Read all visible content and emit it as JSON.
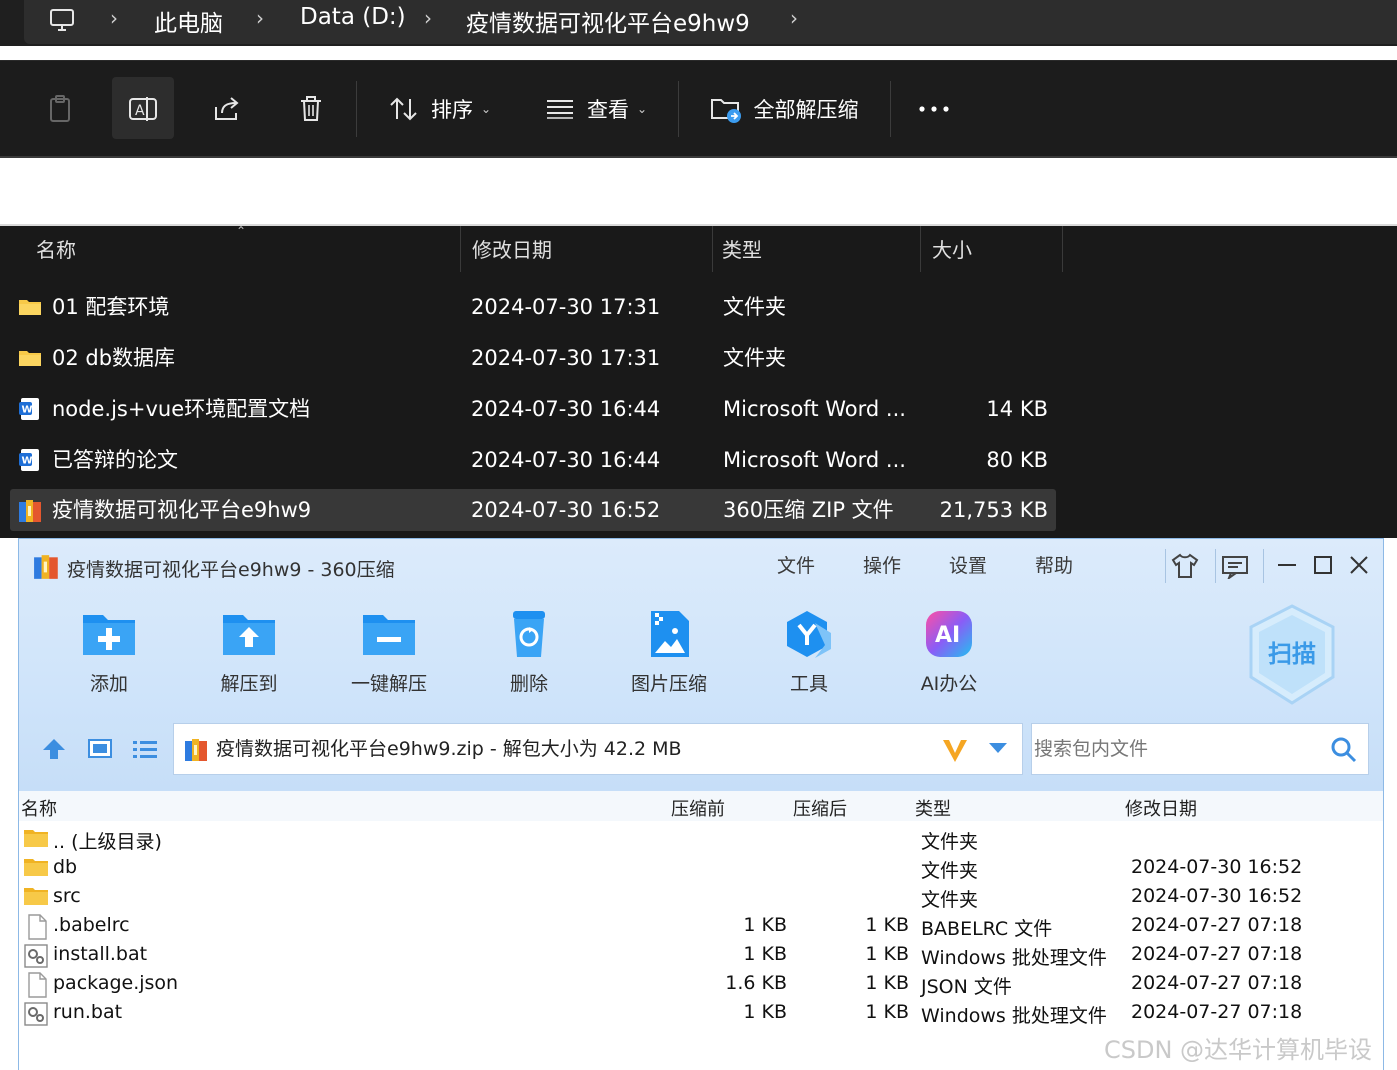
{
  "explorer": {
    "breadcrumb": [
      "此电脑",
      "Data (D:)",
      "疫情数据可视化平台e9hw9"
    ],
    "toolbar": {
      "sort_label": "排序",
      "view_label": "查看",
      "extract_all_label": "全部解压缩"
    },
    "columns": {
      "name": "名称",
      "modified": "修改日期",
      "type": "类型",
      "size": "大小"
    },
    "files": [
      {
        "name": "01 配套环境",
        "modified": "2024-07-30 17:31",
        "type": "文件夹",
        "size": "",
        "icon": "folder-icon"
      },
      {
        "name": "02 db数据库",
        "modified": "2024-07-30 17:31",
        "type": "文件夹",
        "size": "",
        "icon": "folder-icon"
      },
      {
        "name": "node.js+vue环境配置文档",
        "modified": "2024-07-30 16:44",
        "type": "Microsoft Word ...",
        "size": "14 KB",
        "icon": "word-doc-icon"
      },
      {
        "name": "已答辩的论文",
        "modified": "2024-07-30 16:44",
        "type": "Microsoft Word ...",
        "size": "80 KB",
        "icon": "word-doc-icon"
      },
      {
        "name": "疫情数据可视化平台e9hw9",
        "modified": "2024-07-30 16:52",
        "type": "360压缩 ZIP 文件",
        "size": "21,753 KB",
        "icon": "zip-archive-icon"
      }
    ]
  },
  "zip": {
    "title": "疫情数据可视化平台e9hw9 - 360压缩",
    "menu": [
      "文件",
      "操作",
      "设置",
      "帮助"
    ],
    "tools": [
      {
        "label": "添加",
        "icon": "add-folder-icon"
      },
      {
        "label": "解压到",
        "icon": "extract-folder-icon"
      },
      {
        "label": "一键解压",
        "icon": "one-click-extract-icon"
      },
      {
        "label": "删除",
        "icon": "recycle-bin-icon"
      },
      {
        "label": "图片压缩",
        "icon": "image-compress-icon"
      },
      {
        "label": "工具",
        "icon": "tools-hexagon-icon"
      },
      {
        "label": "AI办公",
        "icon": "ai-office-icon"
      }
    ],
    "scan_label": "扫描",
    "path": "疫情数据可视化平台e9hw9.zip - 解包大小为 42.2 MB",
    "search_placeholder": "搜索包内文件",
    "columns": {
      "name": "名称",
      "before": "压缩前",
      "after": "压缩后",
      "type": "类型",
      "modified": "修改日期"
    },
    "entries": [
      {
        "name": ".. (上级目录)",
        "before": "",
        "after": "",
        "type": "文件夹",
        "modified": "",
        "icon": "folder-icon"
      },
      {
        "name": "db",
        "before": "",
        "after": "",
        "type": "文件夹",
        "modified": "2024-07-30 16:52",
        "icon": "folder-icon"
      },
      {
        "name": "src",
        "before": "",
        "after": "",
        "type": "文件夹",
        "modified": "2024-07-30 16:52",
        "icon": "folder-icon"
      },
      {
        "name": ".babelrc",
        "before": "1 KB",
        "after": "1 KB",
        "type": "BABELRC 文件",
        "modified": "2024-07-27 07:18",
        "icon": "blank-file-icon"
      },
      {
        "name": "install.bat",
        "before": "1 KB",
        "after": "1 KB",
        "type": "Windows 批处理文件",
        "modified": "2024-07-27 07:18",
        "icon": "batch-file-icon"
      },
      {
        "name": "package.json",
        "before": "1.6 KB",
        "after": "1 KB",
        "type": "JSON 文件",
        "modified": "2024-07-27 07:18",
        "icon": "blank-file-icon"
      },
      {
        "name": "run.bat",
        "before": "1 KB",
        "after": "1 KB",
        "type": "Windows 批处理文件",
        "modified": "2024-07-27 07:18",
        "icon": "batch-file-icon"
      }
    ]
  },
  "watermark": "CSDN @达华计算机毕设",
  "colors": {
    "explorer_bg": "#191919",
    "zip_header": "#cfe4fa",
    "accent_blue": "#1e90f0",
    "folder_yellow": "#f7c948"
  }
}
